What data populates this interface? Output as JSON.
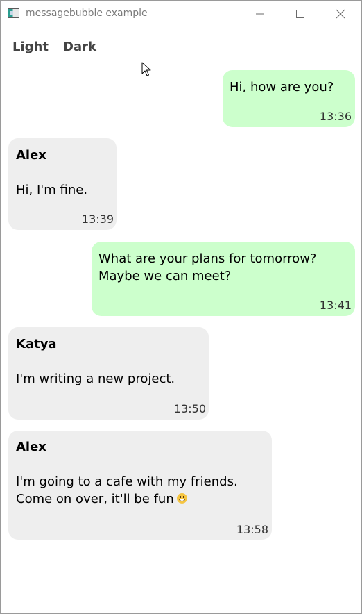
{
  "window": {
    "title": "messagebubble example"
  },
  "theme_tabs": {
    "light_label": "Light",
    "dark_label": "Dark"
  },
  "messages": [
    {
      "direction": "outgoing",
      "sender": "",
      "text": "Hi, how are you?",
      "time": "13:36"
    },
    {
      "direction": "incoming",
      "sender": "Alex",
      "text": "Hi, I'm fine.",
      "time": "13:39"
    },
    {
      "direction": "outgoing",
      "sender": "",
      "text": "What are your plans for tomorrow?\nMaybe we can meet?",
      "time": "13:41"
    },
    {
      "direction": "incoming",
      "sender": "Katya",
      "text": "I'm writing a new project.",
      "time": "13:50"
    },
    {
      "direction": "incoming",
      "sender": "Alex",
      "text": "I'm going to a cafe with my friends. Come on over, it'll be fun",
      "emoji": "grinning-face-emoji",
      "time": "13:58"
    }
  ],
  "colors": {
    "outgoing_bubble": "#ccffcc",
    "incoming_bubble": "#eeeeee",
    "theme_tab_text": "#444444",
    "title_text": "#7a7a7a"
  },
  "icons": {
    "app": "app-icon",
    "minimize": "minimize-icon",
    "maximize": "maximize-icon",
    "close": "close-icon",
    "cursor": "mouse-cursor-icon"
  }
}
